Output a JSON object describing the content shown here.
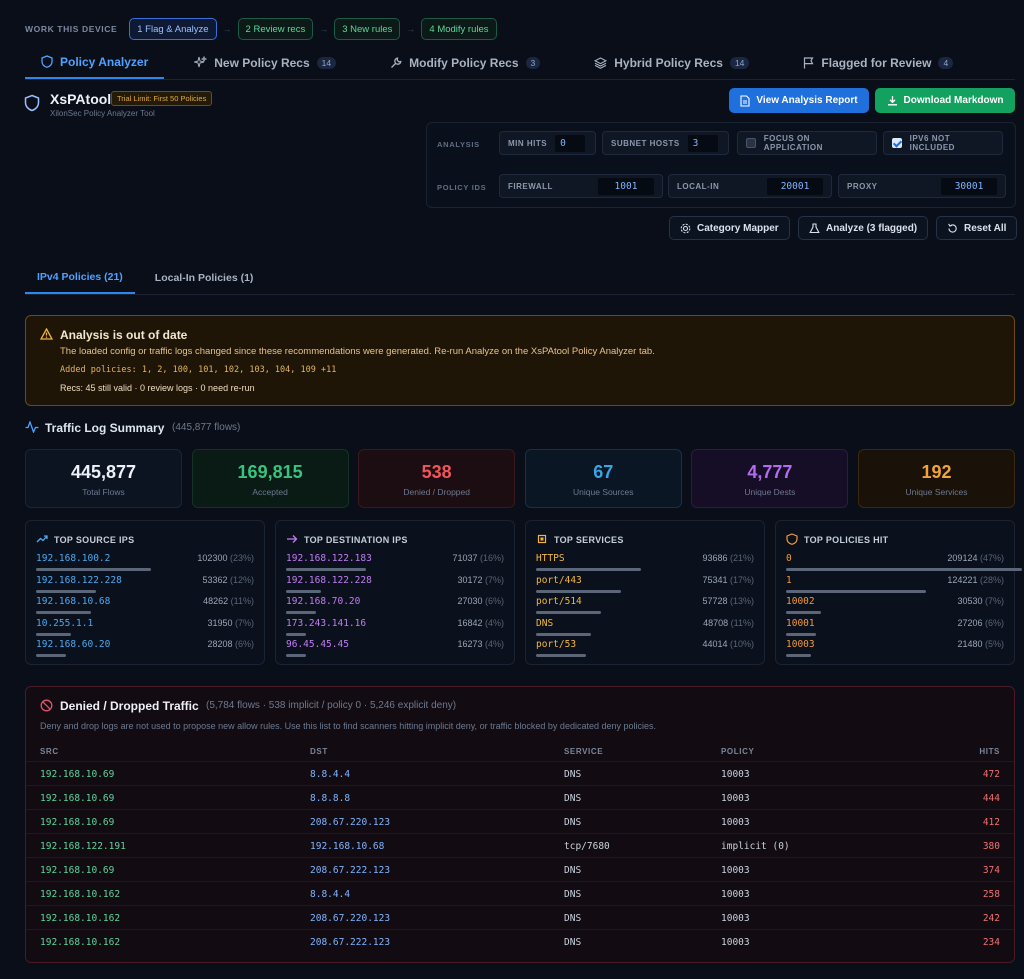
{
  "workflow": {
    "label": "WORK THIS DEVICE",
    "steps": [
      "1 Flag & Analyze",
      "2 Review recs",
      "3 New rules",
      "4 Modify rules"
    ],
    "separator": "→"
  },
  "tabs": [
    {
      "label": "Policy Analyzer",
      "icon": "shield-icon",
      "count": ""
    },
    {
      "label": "New Policy Recs",
      "icon": "sparkle-icon",
      "count": "14"
    },
    {
      "label": "Modify Policy Recs",
      "icon": "wrench-icon",
      "count": "3"
    },
    {
      "label": "Hybrid Policy Recs",
      "icon": "layers-icon",
      "count": "14"
    },
    {
      "label": "Flagged for Review",
      "icon": "flag-icon",
      "count": "4"
    }
  ],
  "app": {
    "title": "XsPAtool",
    "trial": "Trial Limit: First 50 Policies",
    "subtitle": "XilonSec Policy Analyzer Tool"
  },
  "actions": {
    "view_report": "View Analysis Report",
    "download": "Download Markdown"
  },
  "analysis": {
    "label": "ANALYSIS",
    "min_hits_label": "MIN HITS",
    "min_hits": "0",
    "subnet_hosts_label": "SUBNET HOSTS",
    "subnet_hosts": "3",
    "focus_label": "FOCUS ON APPLICATION",
    "focus_checked": false,
    "ipv6_label": "IPV6 NOT INCLUDED",
    "ipv6_checked": true
  },
  "policy_ids": {
    "label": "POLICY IDS",
    "firewall_label": "FIREWALL",
    "firewall": "1001",
    "localin_label": "LOCAL-IN",
    "localin": "20001",
    "proxy_label": "PROXY",
    "proxy": "30001"
  },
  "toolbar": {
    "category_mapper": "Category Mapper",
    "analyze": "Analyze (3 flagged)",
    "reset": "Reset All"
  },
  "subtabs": [
    "IPv4 Policies (21)",
    "Local-In Policies (1)"
  ],
  "warning": {
    "title": "Analysis is out of date",
    "message": "The loaded config or traffic logs changed since these recommendations were generated. Re-run Analyze on the XsPAtool Policy Analyzer tab.",
    "added": "Added policies: 1, 2, 100, 101, 102, 103, 104, 109 +11",
    "recs": "Recs: 45 still valid · 0 review logs · 0 need re-run"
  },
  "traffic": {
    "title": "Traffic Log Summary",
    "subtitle": "(445,877 flows)",
    "stats": [
      {
        "value": "445,877",
        "label": "Total Flows",
        "color": "#eef2f8",
        "bg": "#0c1422",
        "border": "#1c2536"
      },
      {
        "value": "169,815",
        "label": "Accepted",
        "color": "#36c47e",
        "bg": "#0a1a15",
        "border": "#163126"
      },
      {
        "value": "538",
        "label": "Denied / Dropped",
        "color": "#f2545b",
        "bg": "#1c0d12",
        "border": "#3a1820"
      },
      {
        "value": "67",
        "label": "Unique Sources",
        "color": "#39a5e6",
        "bg": "#0a1624",
        "border": "#16304a"
      },
      {
        "value": "4,777",
        "label": "Unique Dests",
        "color": "#b26cf0",
        "bg": "#160d26",
        "border": "#2e1a4a"
      },
      {
        "value": "192",
        "label": "Unique Services",
        "color": "#f0a43c",
        "bg": "#1a1209",
        "border": "#3a2810"
      }
    ]
  },
  "top_lists": [
    {
      "title": "TOP SOURCE IPS",
      "icon": "trend-up-icon",
      "key_color": "#4aa8f0",
      "rows": [
        {
          "k": "192.168.100.2",
          "n": "102300",
          "p": "(23%)",
          "f": 0.23
        },
        {
          "k": "192.168.122.228",
          "n": "53362",
          "p": "(12%)",
          "f": 0.12
        },
        {
          "k": "192.168.10.68",
          "n": "48262",
          "p": "(11%)",
          "f": 0.11
        },
        {
          "k": "10.255.1.1",
          "n": "31950",
          "p": "(7%)",
          "f": 0.07
        },
        {
          "k": "192.168.60.20",
          "n": "28208",
          "p": "(6%)",
          "f": 0.06
        }
      ]
    },
    {
      "title": "TOP DESTINATION IPS",
      "icon": "arrow-right-icon",
      "key_color": "#c07cf2",
      "rows": [
        {
          "k": "192.168.122.183",
          "n": "71037",
          "p": "(16%)",
          "f": 0.16
        },
        {
          "k": "192.168.122.228",
          "n": "30172",
          "p": "(7%)",
          "f": 0.07
        },
        {
          "k": "192.168.70.20",
          "n": "27030",
          "p": "(6%)",
          "f": 0.06
        },
        {
          "k": "173.243.141.16",
          "n": "16842",
          "p": "(4%)",
          "f": 0.04
        },
        {
          "k": "96.45.45.45",
          "n": "16273",
          "p": "(4%)",
          "f": 0.04
        }
      ]
    },
    {
      "title": "TOP SERVICES",
      "icon": "chip-icon",
      "key_color": "#f2b640",
      "rows": [
        {
          "k": "HTTPS",
          "n": "93686",
          "p": "(21%)",
          "f": 0.21
        },
        {
          "k": "port/443",
          "n": "75341",
          "p": "(17%)",
          "f": 0.17
        },
        {
          "k": "port/514",
          "n": "57728",
          "p": "(13%)",
          "f": 0.13
        },
        {
          "k": "DNS",
          "n": "48708",
          "p": "(11%)",
          "f": 0.11
        },
        {
          "k": "port/53",
          "n": "44014",
          "p": "(10%)",
          "f": 0.1
        }
      ]
    },
    {
      "title": "TOP POLICIES HIT",
      "icon": "shield-icon",
      "key_color": "#f29a3a",
      "rows": [
        {
          "k": "0",
          "n": "209124",
          "p": "(47%)",
          "f": 0.47
        },
        {
          "k": "1",
          "n": "124221",
          "p": "(28%)",
          "f": 0.28
        },
        {
          "k": "10002",
          "n": "30530",
          "p": "(7%)",
          "f": 0.07
        },
        {
          "k": "10001",
          "n": "27206",
          "p": "(6%)",
          "f": 0.06
        },
        {
          "k": "10003",
          "n": "21480",
          "p": "(5%)",
          "f": 0.05
        }
      ]
    }
  ],
  "denied": {
    "title": "Denied / Dropped Traffic",
    "subtitle": "(5,784 flows · 538 implicit / policy 0 · 5,246 explicit deny)",
    "description": "Deny and drop logs are not used to propose new allow rules. Use this list to find scanners hitting implicit deny, or traffic blocked by dedicated deny policies.",
    "columns": [
      "SRC",
      "DST",
      "SERVICE",
      "POLICY",
      "HITS"
    ],
    "rows": [
      [
        "192.168.10.69",
        "8.8.4.4",
        "DNS",
        "10003",
        "472"
      ],
      [
        "192.168.10.69",
        "8.8.8.8",
        "DNS",
        "10003",
        "444"
      ],
      [
        "192.168.10.69",
        "208.67.220.123",
        "DNS",
        "10003",
        "412"
      ],
      [
        "192.168.122.191",
        "192.168.10.68",
        "tcp/7680",
        "implicit (0)",
        "380"
      ],
      [
        "192.168.10.69",
        "208.67.222.123",
        "DNS",
        "10003",
        "374"
      ],
      [
        "192.168.10.162",
        "8.8.4.4",
        "DNS",
        "10003",
        "258"
      ],
      [
        "192.168.10.162",
        "208.67.220.123",
        "DNS",
        "10003",
        "242"
      ],
      [
        "192.168.10.162",
        "208.67.222.123",
        "DNS",
        "10003",
        "234"
      ]
    ]
  }
}
